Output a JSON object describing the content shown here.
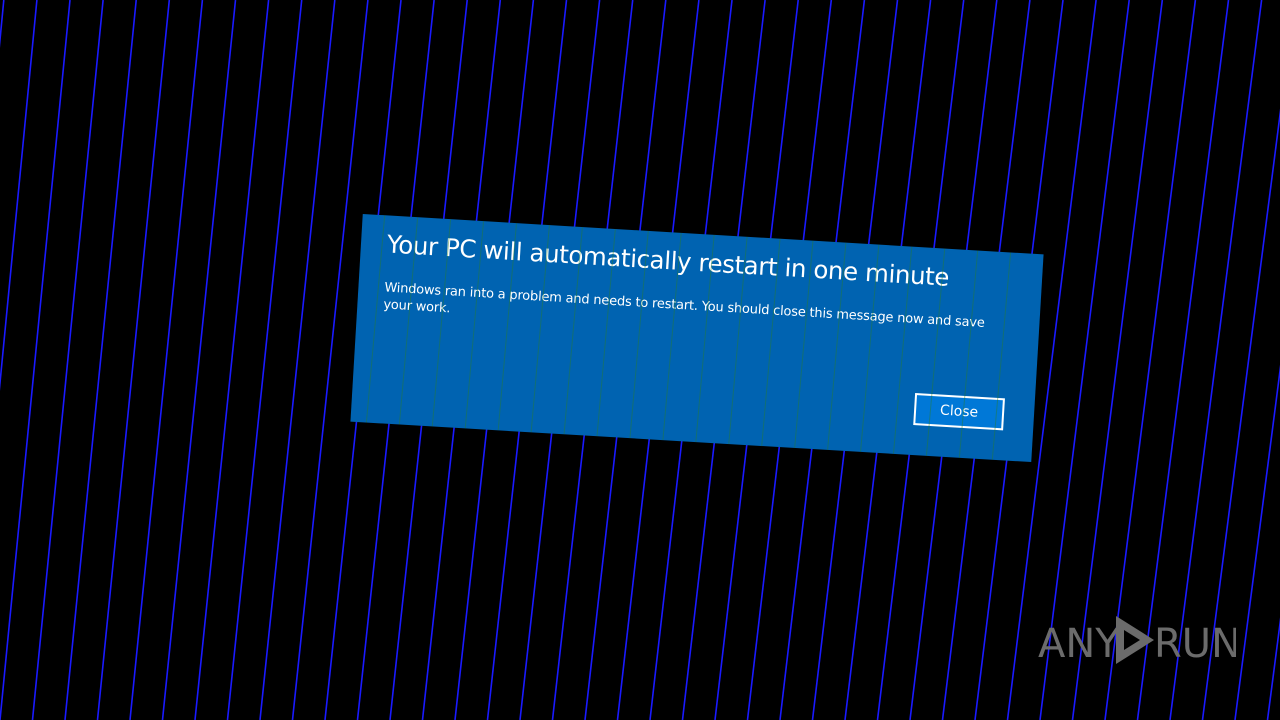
{
  "dialog": {
    "title": "Your PC will automatically restart in one minute",
    "message": "Windows ran into a problem and needs to restart. You should close this message now and save your work.",
    "close_label": "Close"
  },
  "watermark": {
    "text": "ANY RUN"
  },
  "colors": {
    "background": "#000000",
    "stripe": "#1a1aff",
    "dialog_background": "#0063b1",
    "button_background": "#0078d7",
    "text": "#ffffff",
    "watermark": "#6b6b6b"
  }
}
